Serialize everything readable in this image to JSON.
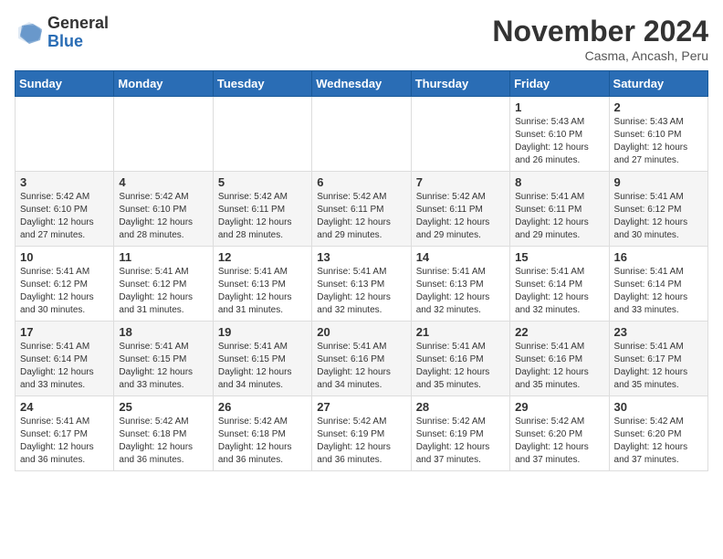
{
  "header": {
    "logo_general": "General",
    "logo_blue": "Blue",
    "month_title": "November 2024",
    "location": "Casma, Ancash, Peru"
  },
  "days_of_week": [
    "Sunday",
    "Monday",
    "Tuesday",
    "Wednesday",
    "Thursday",
    "Friday",
    "Saturday"
  ],
  "weeks": [
    [
      {
        "day": "",
        "info": ""
      },
      {
        "day": "",
        "info": ""
      },
      {
        "day": "",
        "info": ""
      },
      {
        "day": "",
        "info": ""
      },
      {
        "day": "",
        "info": ""
      },
      {
        "day": "1",
        "info": "Sunrise: 5:43 AM\nSunset: 6:10 PM\nDaylight: 12 hours and 26 minutes."
      },
      {
        "day": "2",
        "info": "Sunrise: 5:43 AM\nSunset: 6:10 PM\nDaylight: 12 hours and 27 minutes."
      }
    ],
    [
      {
        "day": "3",
        "info": "Sunrise: 5:42 AM\nSunset: 6:10 PM\nDaylight: 12 hours and 27 minutes."
      },
      {
        "day": "4",
        "info": "Sunrise: 5:42 AM\nSunset: 6:10 PM\nDaylight: 12 hours and 28 minutes."
      },
      {
        "day": "5",
        "info": "Sunrise: 5:42 AM\nSunset: 6:11 PM\nDaylight: 12 hours and 28 minutes."
      },
      {
        "day": "6",
        "info": "Sunrise: 5:42 AM\nSunset: 6:11 PM\nDaylight: 12 hours and 29 minutes."
      },
      {
        "day": "7",
        "info": "Sunrise: 5:42 AM\nSunset: 6:11 PM\nDaylight: 12 hours and 29 minutes."
      },
      {
        "day": "8",
        "info": "Sunrise: 5:41 AM\nSunset: 6:11 PM\nDaylight: 12 hours and 29 minutes."
      },
      {
        "day": "9",
        "info": "Sunrise: 5:41 AM\nSunset: 6:12 PM\nDaylight: 12 hours and 30 minutes."
      }
    ],
    [
      {
        "day": "10",
        "info": "Sunrise: 5:41 AM\nSunset: 6:12 PM\nDaylight: 12 hours and 30 minutes."
      },
      {
        "day": "11",
        "info": "Sunrise: 5:41 AM\nSunset: 6:12 PM\nDaylight: 12 hours and 31 minutes."
      },
      {
        "day": "12",
        "info": "Sunrise: 5:41 AM\nSunset: 6:13 PM\nDaylight: 12 hours and 31 minutes."
      },
      {
        "day": "13",
        "info": "Sunrise: 5:41 AM\nSunset: 6:13 PM\nDaylight: 12 hours and 32 minutes."
      },
      {
        "day": "14",
        "info": "Sunrise: 5:41 AM\nSunset: 6:13 PM\nDaylight: 12 hours and 32 minutes."
      },
      {
        "day": "15",
        "info": "Sunrise: 5:41 AM\nSunset: 6:14 PM\nDaylight: 12 hours and 32 minutes."
      },
      {
        "day": "16",
        "info": "Sunrise: 5:41 AM\nSunset: 6:14 PM\nDaylight: 12 hours and 33 minutes."
      }
    ],
    [
      {
        "day": "17",
        "info": "Sunrise: 5:41 AM\nSunset: 6:14 PM\nDaylight: 12 hours and 33 minutes."
      },
      {
        "day": "18",
        "info": "Sunrise: 5:41 AM\nSunset: 6:15 PM\nDaylight: 12 hours and 33 minutes."
      },
      {
        "day": "19",
        "info": "Sunrise: 5:41 AM\nSunset: 6:15 PM\nDaylight: 12 hours and 34 minutes."
      },
      {
        "day": "20",
        "info": "Sunrise: 5:41 AM\nSunset: 6:16 PM\nDaylight: 12 hours and 34 minutes."
      },
      {
        "day": "21",
        "info": "Sunrise: 5:41 AM\nSunset: 6:16 PM\nDaylight: 12 hours and 35 minutes."
      },
      {
        "day": "22",
        "info": "Sunrise: 5:41 AM\nSunset: 6:16 PM\nDaylight: 12 hours and 35 minutes."
      },
      {
        "day": "23",
        "info": "Sunrise: 5:41 AM\nSunset: 6:17 PM\nDaylight: 12 hours and 35 minutes."
      }
    ],
    [
      {
        "day": "24",
        "info": "Sunrise: 5:41 AM\nSunset: 6:17 PM\nDaylight: 12 hours and 36 minutes."
      },
      {
        "day": "25",
        "info": "Sunrise: 5:42 AM\nSunset: 6:18 PM\nDaylight: 12 hours and 36 minutes."
      },
      {
        "day": "26",
        "info": "Sunrise: 5:42 AM\nSunset: 6:18 PM\nDaylight: 12 hours and 36 minutes."
      },
      {
        "day": "27",
        "info": "Sunrise: 5:42 AM\nSunset: 6:19 PM\nDaylight: 12 hours and 36 minutes."
      },
      {
        "day": "28",
        "info": "Sunrise: 5:42 AM\nSunset: 6:19 PM\nDaylight: 12 hours and 37 minutes."
      },
      {
        "day": "29",
        "info": "Sunrise: 5:42 AM\nSunset: 6:20 PM\nDaylight: 12 hours and 37 minutes."
      },
      {
        "day": "30",
        "info": "Sunrise: 5:42 AM\nSunset: 6:20 PM\nDaylight: 12 hours and 37 minutes."
      }
    ]
  ]
}
